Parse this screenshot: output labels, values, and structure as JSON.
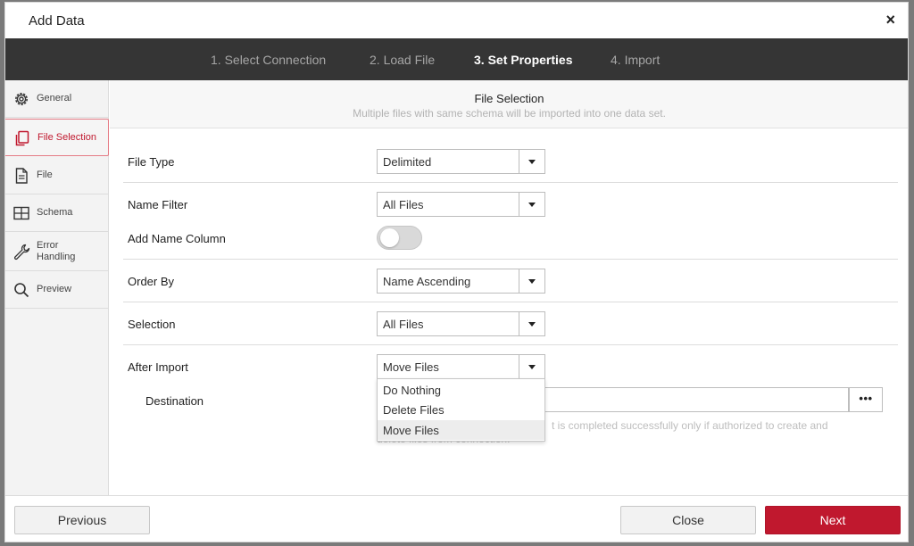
{
  "dialog": {
    "title": "Add Data",
    "close_glyph": "×"
  },
  "steps": [
    "1. Select Connection",
    "2. Load File",
    "3. Set Properties",
    "4. Import"
  ],
  "active_step": 2,
  "sidebar": {
    "items": [
      {
        "label": "General",
        "icon": "gear-icon"
      },
      {
        "label": "File Selection",
        "icon": "copy-files-icon",
        "active": true
      },
      {
        "label": "File",
        "icon": "file-icon"
      },
      {
        "label": "Schema",
        "icon": "table-icon"
      },
      {
        "label": "Error Handling",
        "icon": "wrench-icon"
      },
      {
        "label": "Preview",
        "icon": "magnifier-icon"
      }
    ]
  },
  "section": {
    "title": "File Selection",
    "subtitle": "Multiple files with same schema will be imported into one data set."
  },
  "form": {
    "file_type": {
      "label": "File Type",
      "value": "Delimited"
    },
    "name_filter": {
      "label": "Name Filter",
      "value": "All Files"
    },
    "add_name_column": {
      "label": "Add Name Column",
      "on": false
    },
    "order_by": {
      "label": "Order By",
      "value": "Name Ascending"
    },
    "selection": {
      "label": "Selection",
      "value": "All Files"
    },
    "after_import": {
      "label": "After Import",
      "value": "Move Files",
      "options": [
        "Do Nothing",
        "Delete Files",
        "Move Files"
      ],
      "highlighted": "Move Files"
    },
    "destination": {
      "label": "Destination",
      "value": "",
      "browse_label": "•••",
      "hint_visible": "t is completed successfully only if authorized to create and",
      "hint_visible_2": "delete files from connection."
    }
  },
  "footer": {
    "previous": "Previous",
    "close": "Close",
    "next": "Next"
  },
  "colors": {
    "accent": "#c0182e",
    "stepbar": "#353535"
  }
}
